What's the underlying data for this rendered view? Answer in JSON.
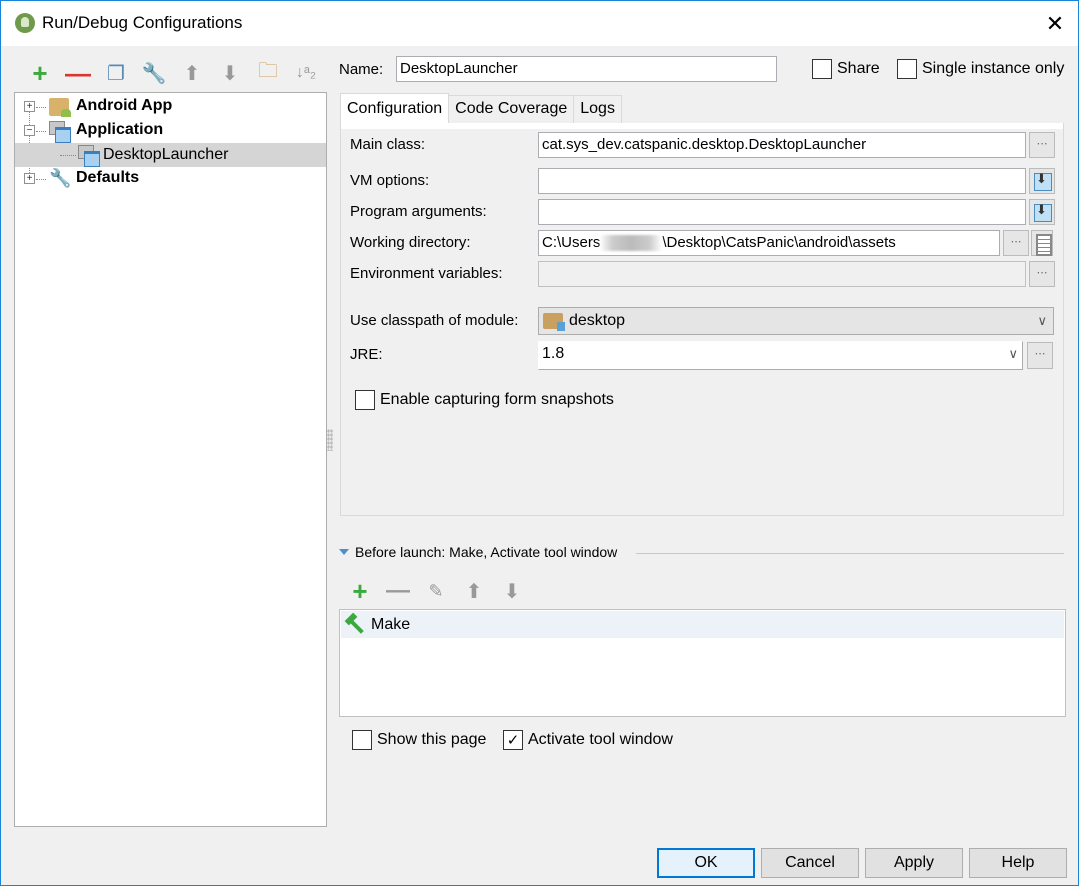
{
  "window": {
    "title": "Run/Debug Configurations",
    "app_icon": "android-studio-icon",
    "close_icon": "✕"
  },
  "left_toolbar": [
    {
      "name": "add-config",
      "icon": "plus-icon",
      "glyph": "+"
    },
    {
      "name": "remove-config",
      "icon": "minus-icon",
      "glyph": "—"
    },
    {
      "name": "copy-config",
      "icon": "copy-icon",
      "glyph": "❐"
    },
    {
      "name": "edit-defaults",
      "icon": "wrench-icon",
      "glyph": "🔧"
    },
    {
      "name": "move-up",
      "icon": "arrow-up-icon",
      "glyph": "⬆"
    },
    {
      "name": "move-down",
      "icon": "arrow-down-icon",
      "glyph": "⬇"
    },
    {
      "name": "folder",
      "icon": "folder-icon",
      "glyph": "🗀"
    },
    {
      "name": "sort",
      "icon": "sort-alpha-icon",
      "glyph": "↓ᵃ₂"
    }
  ],
  "tree": {
    "nodes": [
      {
        "label": "Android App",
        "expanded": false,
        "bold": true,
        "icon": "android-folder-icon"
      },
      {
        "label": "Application",
        "expanded": true,
        "bold": true,
        "icon": "application-icon"
      },
      {
        "label": "DesktopLauncher",
        "child": true,
        "selected": true,
        "icon": "application-icon"
      },
      {
        "label": "Defaults",
        "expanded": false,
        "bold": true,
        "icon": "wrench-icon"
      }
    ]
  },
  "header": {
    "name_label": "Name:",
    "name_value": "DesktopLauncher",
    "share_label": "Share",
    "share_checked": false,
    "single_instance_label": "Single instance only",
    "single_instance_checked": false
  },
  "tabs": [
    {
      "label": "Configuration",
      "active": true
    },
    {
      "label": "Code Coverage",
      "active": false
    },
    {
      "label": "Logs",
      "active": false
    }
  ],
  "config": {
    "main_class_label": "Main class:",
    "main_class_value": "cat.sys_dev.catspanic.desktop.DesktopLauncher",
    "vm_options_label": "VM options:",
    "vm_options_value": "",
    "program_args_label": "Program arguments:",
    "program_args_value": "",
    "working_dir_label": "Working directory:",
    "working_dir_prefix": "C:\\Users",
    "working_dir_suffix": "\\Desktop\\CatsPanic\\android\\assets",
    "env_vars_label": "Environment variables:",
    "env_vars_value": "",
    "classpath_label": "Use classpath of module:",
    "classpath_value": "desktop",
    "jre_label": "JRE:",
    "jre_value": "1.8",
    "snapshots_label": "Enable capturing form snapshots",
    "snapshots_checked": false,
    "ellipsis": "⋯",
    "chevron": "∨"
  },
  "before_launch": {
    "title": "Before launch: Make, Activate tool window",
    "toolbar": [
      {
        "name": "add-task",
        "icon": "plus-icon",
        "glyph": "+"
      },
      {
        "name": "remove-task",
        "icon": "minus-icon",
        "glyph": "—"
      },
      {
        "name": "edit-task",
        "icon": "pencil-icon",
        "glyph": "✎"
      },
      {
        "name": "move-task-up",
        "icon": "arrow-up-icon",
        "glyph": "⬆"
      },
      {
        "name": "move-task-down",
        "icon": "arrow-down-icon",
        "glyph": "⬇"
      }
    ],
    "tasks": [
      {
        "label": "Make",
        "icon": "hammer-icon"
      }
    ],
    "show_page_label": "Show this page",
    "show_page_checked": false,
    "activate_tool_label": "Activate tool window",
    "activate_tool_checked": true,
    "check_glyph": "✓"
  },
  "buttons": {
    "ok": "OK",
    "cancel": "Cancel",
    "apply": "Apply",
    "help": "Help"
  },
  "colors": {
    "accent": "#0078d7",
    "window_border": "#1883d7",
    "add_green": "#3ba93e",
    "remove_red": "#d9362f",
    "selection_gray": "#d5d5d5"
  }
}
